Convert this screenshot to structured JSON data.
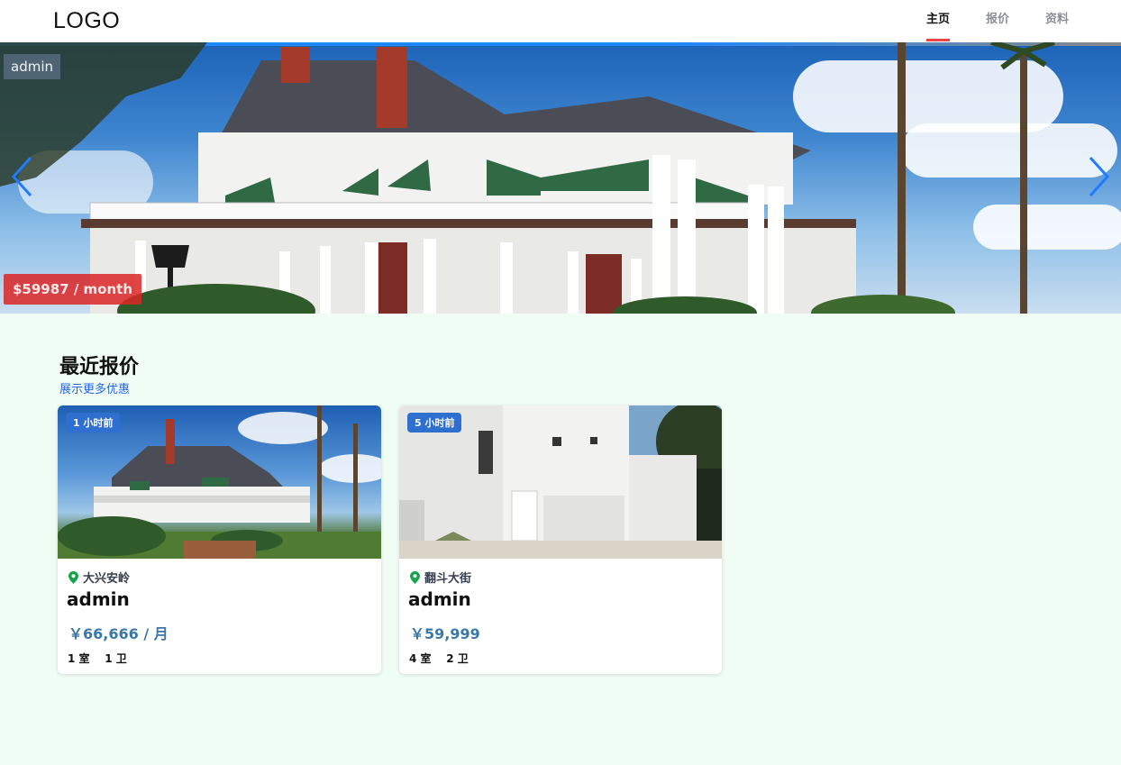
{
  "header": {
    "logo": "LOGO",
    "nav": [
      {
        "label": "主页",
        "active": true
      },
      {
        "label": "报价",
        "active": false
      },
      {
        "label": "资料",
        "active": false
      }
    ]
  },
  "hero": {
    "tag": "admin",
    "price": "$59987 / month",
    "prev_icon": "chevron-left-icon",
    "next_icon": "chevron-right-icon"
  },
  "section": {
    "title": "最近报价",
    "link": "展示更多优惠"
  },
  "listings": [
    {
      "time": "1 小时前",
      "location": "大兴安岭",
      "name": "admin",
      "price": "￥66,666 / 月",
      "specs": "1 室    1 卫",
      "icon": "location-pin-icon"
    },
    {
      "time": "5 小时前",
      "location": "翻斗大街",
      "name": "admin",
      "price": "￥59,999",
      "specs": "4 室    2 卫",
      "icon": "location-pin-icon"
    }
  ],
  "colors": {
    "page_bg": "#f0fdf4",
    "accent_red": "#ef4444",
    "badge_blue": "#2f6fcf",
    "price_blue": "#3a78a8",
    "pin_green": "#16a34a"
  }
}
